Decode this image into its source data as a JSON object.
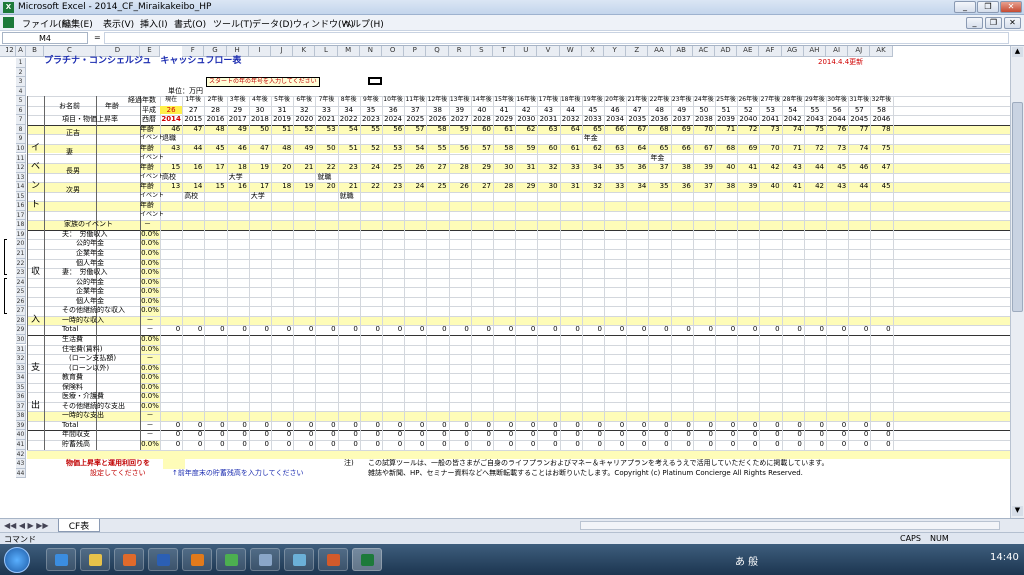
{
  "window": {
    "title": "Microsoft Excel - 2014_CF_Miraikakeibo_HP",
    "minimize": "_",
    "restore": "❐",
    "close": "✕",
    "doc_min": "_",
    "doc_restore": "❐",
    "doc_close": "✕"
  },
  "menu": [
    "ファイル(F)",
    "編集(E)",
    "表示(V)",
    "挿入(I)",
    "書式(O)",
    "ツール(T)",
    "データ(D)",
    "ウィンドウ(W)",
    "ヘルプ(H)"
  ],
  "formula": {
    "name_box": "M4",
    "fx": "="
  },
  "outline_levels": [
    "1",
    "2"
  ],
  "columns": [
    "A",
    "B",
    "C",
    "D",
    "E",
    "F",
    "G",
    "H",
    "I",
    "J",
    "K",
    "L",
    "M",
    "N",
    "O",
    "P",
    "Q",
    "R",
    "S",
    "T",
    "U",
    "V",
    "W",
    "X",
    "Y",
    "Z",
    "AA",
    "AB",
    "AC",
    "AD",
    "AE",
    "AF",
    "AG",
    "AH",
    "AI",
    "AJ",
    "AK"
  ],
  "rows": [
    "1",
    "2",
    "3",
    "4",
    "5",
    "6",
    "7",
    "8",
    "9",
    "10",
    "11",
    "12",
    "13",
    "14",
    "15",
    "16",
    "17",
    "18",
    "19",
    "20",
    "21",
    "22",
    "23",
    "24",
    "25",
    "26",
    "27",
    "28",
    "29",
    "30",
    "31",
    "32",
    "33",
    "34",
    "35",
    "36",
    "37",
    "38",
    "39",
    "40",
    "41",
    "42",
    "43",
    "44"
  ],
  "sheet": {
    "title": "プラチナ・コンシェルジュ　キャッシュフロー表",
    "updated": "2014.4.4更新",
    "callout": "スタートの年の年号を入力してください",
    "unit": "単位：万円",
    "keika_label": "経過年数",
    "heisei_label": "平成",
    "seireki_label": "西暦",
    "name_label": "お名前",
    "nenrei_label": "年齢",
    "koumoku_label": "項目・物価上昇率",
    "elapsed": [
      "現在",
      "1年後",
      "2年後",
      "3年後",
      "4年後",
      "5年後",
      "6年後",
      "7年後",
      "8年後",
      "9年後",
      "10年後",
      "11年後",
      "12年後",
      "13年後",
      "14年後",
      "15年後",
      "16年後",
      "17年後",
      "18年後",
      "19年後",
      "20年後",
      "21年後",
      "22年後",
      "23年後",
      "24年後",
      "25年後",
      "26年後",
      "27年後",
      "28年後",
      "29年後",
      "30年後",
      "31年後",
      "32年後"
    ],
    "heisei": [
      "26",
      "27",
      "28",
      "29",
      "30",
      "31",
      "32",
      "33",
      "34",
      "35",
      "36",
      "37",
      "38",
      "39",
      "40",
      "41",
      "42",
      "43",
      "44",
      "45",
      "46",
      "47",
      "48",
      "49",
      "50",
      "51",
      "52",
      "53",
      "54",
      "55",
      "56",
      "57",
      "58"
    ],
    "years": [
      "2014",
      "2015",
      "2016",
      "2017",
      "2018",
      "2019",
      "2020",
      "2021",
      "2022",
      "2023",
      "2024",
      "2025",
      "2026",
      "2027",
      "2028",
      "2029",
      "2030",
      "2031",
      "2032",
      "2033",
      "2034",
      "2035",
      "2036",
      "2037",
      "2038",
      "2039",
      "2040",
      "2041",
      "2042",
      "2043",
      "2044",
      "2045",
      "2046"
    ],
    "event_side": [
      "イ",
      "ベ",
      "ン",
      "ト"
    ],
    "income_side": [
      "収",
      "入"
    ],
    "expense_side": [
      "支",
      "出"
    ],
    "nenrei": "年齢",
    "event_word": "イベント",
    "members": [
      {
        "name": "正吉",
        "ages": [
          "46",
          "47",
          "48",
          "49",
          "50",
          "51",
          "52",
          "53",
          "54",
          "55",
          "56",
          "57",
          "58",
          "59",
          "60",
          "61",
          "62",
          "63",
          "64",
          "65",
          "66",
          "67",
          "68",
          "69",
          "70",
          "71",
          "72",
          "73",
          "74",
          "75",
          "76",
          "77",
          "78"
        ],
        "events": [
          {
            "col": 0,
            "text": "退職"
          },
          {
            "col": 19,
            "text": "年金"
          }
        ]
      },
      {
        "name": "妻",
        "ages": [
          "43",
          "44",
          "45",
          "46",
          "47",
          "48",
          "49",
          "50",
          "51",
          "52",
          "53",
          "54",
          "55",
          "56",
          "57",
          "58",
          "59",
          "60",
          "61",
          "62",
          "63",
          "64",
          "65",
          "66",
          "67",
          "68",
          "69",
          "70",
          "71",
          "72",
          "73",
          "74",
          "75"
        ],
        "events": [
          {
            "col": 22,
            "text": "年金"
          }
        ]
      },
      {
        "name": "長男",
        "ages": [
          "15",
          "16",
          "17",
          "18",
          "19",
          "20",
          "21",
          "22",
          "23",
          "24",
          "25",
          "26",
          "27",
          "28",
          "29",
          "30",
          "31",
          "32",
          "33",
          "34",
          "35",
          "36",
          "37",
          "38",
          "39",
          "40",
          "41",
          "42",
          "43",
          "44",
          "45",
          "46",
          "47"
        ],
        "events": [
          {
            "col": 0,
            "text": "高校"
          },
          {
            "col": 3,
            "text": "大学"
          },
          {
            "col": 7,
            "text": "就職"
          }
        ]
      },
      {
        "name": "次男",
        "ages": [
          "13",
          "14",
          "15",
          "16",
          "17",
          "18",
          "19",
          "20",
          "21",
          "22",
          "23",
          "24",
          "25",
          "26",
          "27",
          "28",
          "29",
          "30",
          "31",
          "32",
          "33",
          "34",
          "35",
          "36",
          "37",
          "38",
          "39",
          "40",
          "41",
          "42",
          "43",
          "44",
          "45"
        ],
        "events": [
          {
            "col": 1,
            "text": "高校"
          },
          {
            "col": 4,
            "text": "大学"
          },
          {
            "col": 8,
            "text": "就職"
          }
        ]
      }
    ],
    "family_event": "家族のイベント",
    "dash": "－",
    "income_rows": [
      {
        "row": "19",
        "label": "夫：　労働収入",
        "rate": "0.0%"
      },
      {
        "row": "20",
        "label": "　　公的年金",
        "rate": "0.0%"
      },
      {
        "row": "21",
        "label": "　　企業年金",
        "rate": "0.0%"
      },
      {
        "row": "22",
        "label": "　　個人年金",
        "rate": "0.0%"
      },
      {
        "row": "23",
        "label": "妻：　労働収入",
        "rate": "0.0%"
      },
      {
        "row": "24",
        "label": "　　公的年金",
        "rate": "0.0%"
      },
      {
        "row": "25",
        "label": "　　企業年金",
        "rate": "0.0%"
      },
      {
        "row": "26",
        "label": "　　個人年金",
        "rate": "0.0%"
      },
      {
        "row": "27",
        "label": "その他継続的な収入",
        "rate": "0.0%"
      },
      {
        "row": "28",
        "label": "一時的な収入",
        "rate": "－"
      },
      {
        "row": "29",
        "label": "Total",
        "rate": "－"
      }
    ],
    "expense_rows": [
      {
        "row": "30",
        "label": "生活費",
        "rate": "0.0%"
      },
      {
        "row": "31",
        "label": "住宅費(賃料)",
        "rate": "0.0%"
      },
      {
        "row": "32",
        "label": "　(ローン支払額)",
        "rate": "－"
      },
      {
        "row": "33",
        "label": "　(ローン以外)",
        "rate": "0.0%"
      },
      {
        "row": "34",
        "label": "教育費",
        "rate": "0.0%"
      },
      {
        "row": "35",
        "label": "保険料",
        "rate": "0.0%"
      },
      {
        "row": "36",
        "label": "医療・介護費",
        "rate": "0.0%"
      },
      {
        "row": "37",
        "label": "その他継続的な支出",
        "rate": "0.0%"
      },
      {
        "row": "38",
        "label": "一時的な支出",
        "rate": "－"
      },
      {
        "row": "39",
        "label": "Total",
        "rate": "－"
      }
    ],
    "balance_row": {
      "label": "年間収支",
      "rate": "－"
    },
    "savings_row": {
      "label": "貯蓄残高",
      "rate": "0.0%"
    },
    "zero": "0",
    "note_left1": "物価上昇率と運用利回りを",
    "note_left2": "設定してください",
    "note_mid": "↑前年度末の貯蓄残高を入力してください",
    "note_mark": "注)",
    "note_r1": "この試算ツールは、一般の皆さまがご自身のライフプランおよびマネー＆キャリアプランを考えるうえで活用していただくために掲載しています。",
    "note_r2": "雑誌や新聞、HP、セミナー資料などへ無断転載することはお断りいたします。Copyright (c) Platinum Concierge All Rights Reserved."
  },
  "tabs": {
    "sheet": "CF表"
  },
  "status": {
    "mode": "コマンド",
    "caps": "CAPS",
    "num": "NUM"
  },
  "taskbar": {
    "ime": "あ 般",
    "clock": "14:40"
  }
}
